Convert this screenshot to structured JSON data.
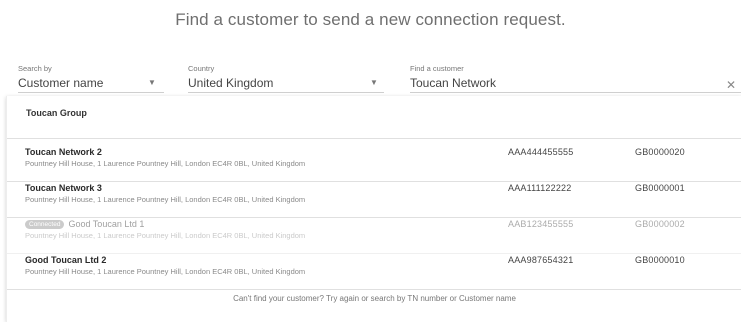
{
  "heading": "Find a customer to send a new connection request.",
  "filters": {
    "search_by": {
      "label": "Search by",
      "value": "Customer name"
    },
    "country": {
      "label": "Country",
      "value": "United Kingdom"
    },
    "find_customer": {
      "label": "Find a customer",
      "value": "Toucan Network"
    },
    "clear_icon": "close-icon"
  },
  "results": {
    "group_title": "Toucan Group",
    "rows": [
      {
        "name": "Toucan Network 2",
        "address": "Pountney Hill House, 1 Laurence Pountney Hill, London EC4R 0BL, United Kingdom",
        "tn": "AAA444455555",
        "code": "GB0000020",
        "badge": ""
      },
      {
        "name": "Toucan Network 3",
        "address": "Pountney Hill House, 1 Laurence Pountney Hill, London EC4R 0BL, United Kingdom",
        "tn": "AAA111122222",
        "code": "GB0000001",
        "badge": ""
      },
      {
        "name": "Good Toucan Ltd 1",
        "address": "Pountney Hill House, 1 Laurence Pountney Hill, London EC4R 0BL, United Kingdom",
        "tn": "AAB123455555",
        "code": "GB0000002",
        "badge": "Connected"
      },
      {
        "name": "Good Toucan Ltd 2",
        "address": "Pountney Hill House, 1 Laurence Pountney Hill, London EC4R 0BL, United Kingdom",
        "tn": "AAA987654321",
        "code": "GB0000010",
        "badge": ""
      }
    ],
    "footer": "Can't find your customer? Try again or search by TN number or Customer name"
  }
}
